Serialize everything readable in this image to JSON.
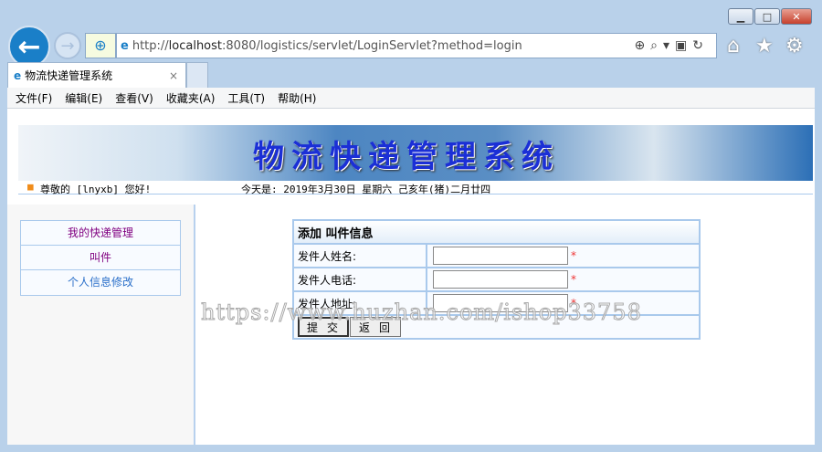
{
  "browser": {
    "url_prefix": "http://",
    "url_host": "localhost",
    "url_rest": ":8080/logistics/servlet/LoginServlet?method=login",
    "tab_title": "物流快递管理系统",
    "tab_close": "×",
    "menu": [
      "文件(F)",
      "编辑(E)",
      "查看(V)",
      "收藏夹(A)",
      "工具(T)",
      "帮助(H)"
    ]
  },
  "banner": {
    "title": "物流快递管理系统"
  },
  "greeting": {
    "text": "尊敬的 [lnyxb] 您好!",
    "date": "今天是: 2019年3月30日 星期六 己亥年(猪)二月廿四"
  },
  "sidebar": {
    "items": [
      "我的快递管理",
      "叫件",
      "个人信息修改"
    ]
  },
  "form": {
    "title": "添加 叫件信息",
    "fields": [
      {
        "label": "发件人姓名:",
        "value": ""
      },
      {
        "label": "发件人电话:",
        "value": ""
      },
      {
        "label": "发件人地址:",
        "value": ""
      }
    ],
    "required_mark": "*",
    "submit": "提交",
    "back": "返回"
  },
  "watermark": "https://www.huzhan.com/ishop33758",
  "colors": {
    "accent": "#1a7fc8",
    "link_visited": "#800080",
    "link": "#2a6fc9",
    "border": "#a9c9ec"
  }
}
